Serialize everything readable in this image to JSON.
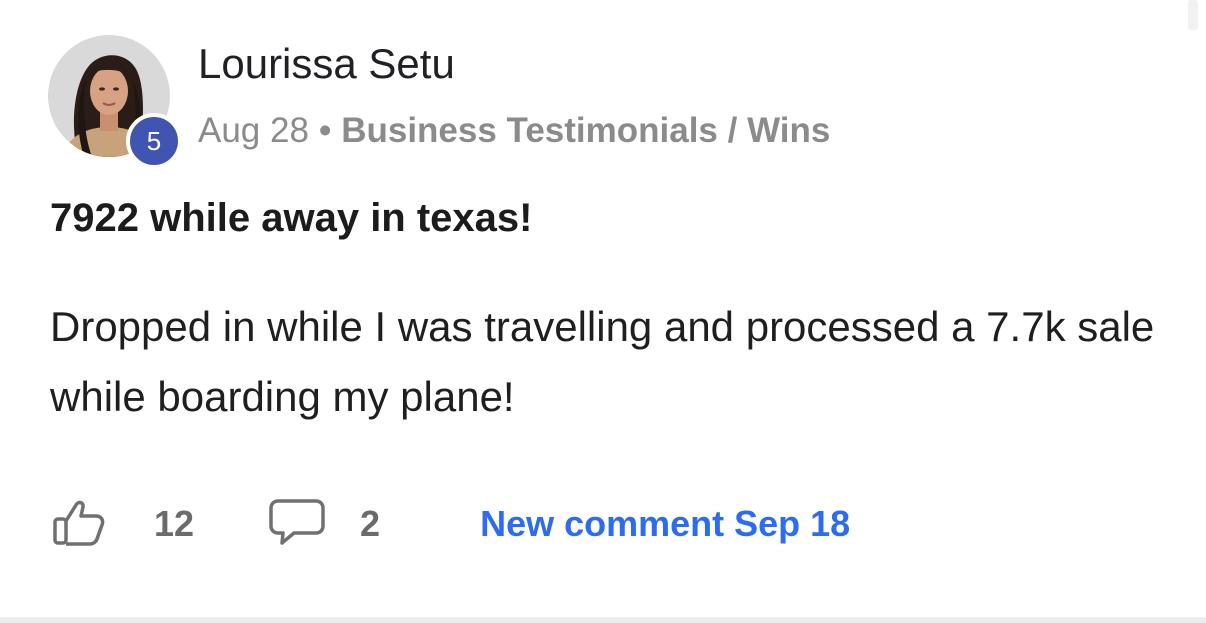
{
  "post": {
    "author": {
      "name": "Lourissa Setu",
      "level": "5"
    },
    "date": "Aug 28",
    "separator": "•",
    "category": "Business Testimonials / Wins",
    "title": "7922 while away in texas!",
    "body": "Dropped in while I was travelling and processed a 7.7k sale while boarding my plane!",
    "likes": "12",
    "comments": "2",
    "new_comment_label": "New comment Sep 18"
  },
  "colors": {
    "level_badge": "#4054b2",
    "link_blue": "#2d6cf0",
    "meta_gray": "#8b8b8b"
  },
  "icons": {
    "like": "thumbs-up-icon",
    "comment": "speech-bubble-icon"
  }
}
